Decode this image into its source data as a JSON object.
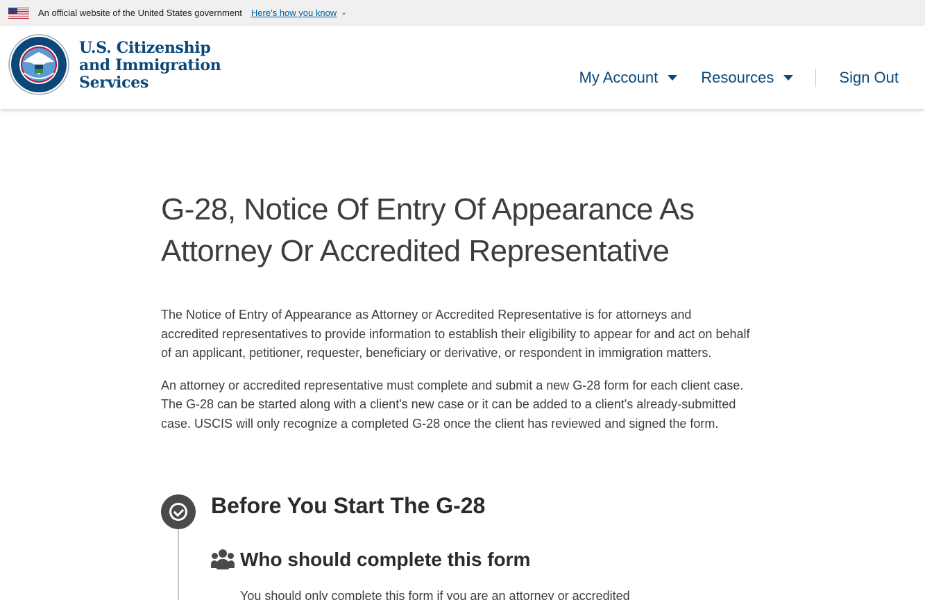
{
  "gov_banner": {
    "text": "An official website of the United States government",
    "link_label": "Here’s how you know",
    "flag_icon": "us-flag-icon"
  },
  "header": {
    "agency_line1": "U.S. Citizenship",
    "agency_line2": "and Immigration",
    "agency_line3": "Services",
    "seal_text_top": "U.S. DEPARTMENT OF",
    "seal_text_bottom": "HOMELAND SECURITY",
    "nav": {
      "my_account": "My Account",
      "resources": "Resources",
      "sign_out": "Sign Out"
    }
  },
  "main": {
    "title": "G-28, Notice Of Entry Of Appearance As Attorney Or Accredited Representative",
    "paragraph1": "The Notice of Entry of Appearance as Attorney or Accredited Representative is for attorneys and accredited representatives to provide information to establish their eligibility to appear for and act on behalf of an applicant, petitioner, requester, beneficiary or derivative, or respondent in immigration matters.",
    "paragraph2": "An attorney or accredited representative must complete and submit a new G-28 form for each client case. The G-28 can be started along with a client's new case or it can be added to a client's already-submitted case. USCIS will only recognize a completed G-28 once the client has reviewed and signed the form.",
    "step_title": "Before You Start The G-28",
    "section_title": "Who should complete this form",
    "section_text": "You should only complete this form if you are an attorney or accredited"
  },
  "colors": {
    "brand_blue": "#0b4778",
    "link_blue": "#005ea2",
    "banner_bg": "#f0f0f0",
    "text_gray": "#3d3d3d"
  }
}
